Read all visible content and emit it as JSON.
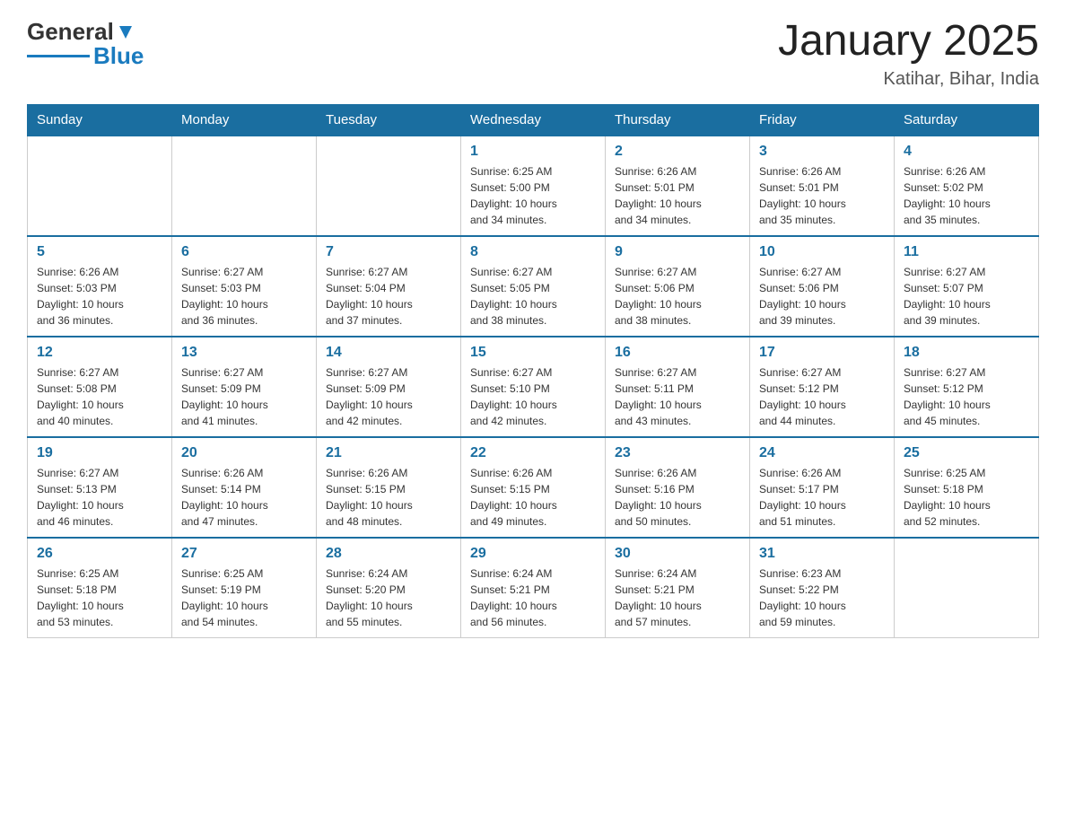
{
  "header": {
    "logo_general": "General",
    "logo_blue": "Blue",
    "month_title": "January 2025",
    "location": "Katihar, Bihar, India"
  },
  "weekdays": [
    "Sunday",
    "Monday",
    "Tuesday",
    "Wednesday",
    "Thursday",
    "Friday",
    "Saturday"
  ],
  "weeks": [
    [
      {
        "day": "",
        "info": ""
      },
      {
        "day": "",
        "info": ""
      },
      {
        "day": "",
        "info": ""
      },
      {
        "day": "1",
        "info": "Sunrise: 6:25 AM\nSunset: 5:00 PM\nDaylight: 10 hours\nand 34 minutes."
      },
      {
        "day": "2",
        "info": "Sunrise: 6:26 AM\nSunset: 5:01 PM\nDaylight: 10 hours\nand 34 minutes."
      },
      {
        "day": "3",
        "info": "Sunrise: 6:26 AM\nSunset: 5:01 PM\nDaylight: 10 hours\nand 35 minutes."
      },
      {
        "day": "4",
        "info": "Sunrise: 6:26 AM\nSunset: 5:02 PM\nDaylight: 10 hours\nand 35 minutes."
      }
    ],
    [
      {
        "day": "5",
        "info": "Sunrise: 6:26 AM\nSunset: 5:03 PM\nDaylight: 10 hours\nand 36 minutes."
      },
      {
        "day": "6",
        "info": "Sunrise: 6:27 AM\nSunset: 5:03 PM\nDaylight: 10 hours\nand 36 minutes."
      },
      {
        "day": "7",
        "info": "Sunrise: 6:27 AM\nSunset: 5:04 PM\nDaylight: 10 hours\nand 37 minutes."
      },
      {
        "day": "8",
        "info": "Sunrise: 6:27 AM\nSunset: 5:05 PM\nDaylight: 10 hours\nand 38 minutes."
      },
      {
        "day": "9",
        "info": "Sunrise: 6:27 AM\nSunset: 5:06 PM\nDaylight: 10 hours\nand 38 minutes."
      },
      {
        "day": "10",
        "info": "Sunrise: 6:27 AM\nSunset: 5:06 PM\nDaylight: 10 hours\nand 39 minutes."
      },
      {
        "day": "11",
        "info": "Sunrise: 6:27 AM\nSunset: 5:07 PM\nDaylight: 10 hours\nand 39 minutes."
      }
    ],
    [
      {
        "day": "12",
        "info": "Sunrise: 6:27 AM\nSunset: 5:08 PM\nDaylight: 10 hours\nand 40 minutes."
      },
      {
        "day": "13",
        "info": "Sunrise: 6:27 AM\nSunset: 5:09 PM\nDaylight: 10 hours\nand 41 minutes."
      },
      {
        "day": "14",
        "info": "Sunrise: 6:27 AM\nSunset: 5:09 PM\nDaylight: 10 hours\nand 42 minutes."
      },
      {
        "day": "15",
        "info": "Sunrise: 6:27 AM\nSunset: 5:10 PM\nDaylight: 10 hours\nand 42 minutes."
      },
      {
        "day": "16",
        "info": "Sunrise: 6:27 AM\nSunset: 5:11 PM\nDaylight: 10 hours\nand 43 minutes."
      },
      {
        "day": "17",
        "info": "Sunrise: 6:27 AM\nSunset: 5:12 PM\nDaylight: 10 hours\nand 44 minutes."
      },
      {
        "day": "18",
        "info": "Sunrise: 6:27 AM\nSunset: 5:12 PM\nDaylight: 10 hours\nand 45 minutes."
      }
    ],
    [
      {
        "day": "19",
        "info": "Sunrise: 6:27 AM\nSunset: 5:13 PM\nDaylight: 10 hours\nand 46 minutes."
      },
      {
        "day": "20",
        "info": "Sunrise: 6:26 AM\nSunset: 5:14 PM\nDaylight: 10 hours\nand 47 minutes."
      },
      {
        "day": "21",
        "info": "Sunrise: 6:26 AM\nSunset: 5:15 PM\nDaylight: 10 hours\nand 48 minutes."
      },
      {
        "day": "22",
        "info": "Sunrise: 6:26 AM\nSunset: 5:15 PM\nDaylight: 10 hours\nand 49 minutes."
      },
      {
        "day": "23",
        "info": "Sunrise: 6:26 AM\nSunset: 5:16 PM\nDaylight: 10 hours\nand 50 minutes."
      },
      {
        "day": "24",
        "info": "Sunrise: 6:26 AM\nSunset: 5:17 PM\nDaylight: 10 hours\nand 51 minutes."
      },
      {
        "day": "25",
        "info": "Sunrise: 6:25 AM\nSunset: 5:18 PM\nDaylight: 10 hours\nand 52 minutes."
      }
    ],
    [
      {
        "day": "26",
        "info": "Sunrise: 6:25 AM\nSunset: 5:18 PM\nDaylight: 10 hours\nand 53 minutes."
      },
      {
        "day": "27",
        "info": "Sunrise: 6:25 AM\nSunset: 5:19 PM\nDaylight: 10 hours\nand 54 minutes."
      },
      {
        "day": "28",
        "info": "Sunrise: 6:24 AM\nSunset: 5:20 PM\nDaylight: 10 hours\nand 55 minutes."
      },
      {
        "day": "29",
        "info": "Sunrise: 6:24 AM\nSunset: 5:21 PM\nDaylight: 10 hours\nand 56 minutes."
      },
      {
        "day": "30",
        "info": "Sunrise: 6:24 AM\nSunset: 5:21 PM\nDaylight: 10 hours\nand 57 minutes."
      },
      {
        "day": "31",
        "info": "Sunrise: 6:23 AM\nSunset: 5:22 PM\nDaylight: 10 hours\nand 59 minutes."
      },
      {
        "day": "",
        "info": ""
      }
    ]
  ]
}
